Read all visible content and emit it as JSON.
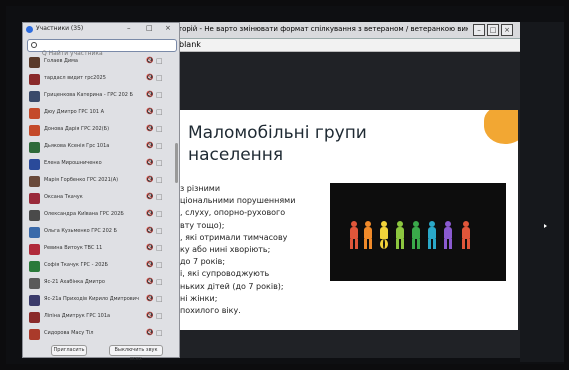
{
  "zoom_window": {
    "title": "торій - Не варто змінювати формат спілкування з ветераном / ветеранкою виключно ч...",
    "doc_name": "blank"
  },
  "slide": {
    "title": "Маломобільні групи населення",
    "bullets": [
      "з різними",
      "ціональними порушеннями",
      ", слуху, опорно-рухового",
      "вту тощо);",
      ", які отримали тимчасову",
      "ку або нині хворіють;",
      "до 7 років;",
      "і, які супроводжують",
      "ньких дітей (до 7 років);",
      "ні жінки;",
      "похилого віку."
    ],
    "accent_color": "#f2a733",
    "image": "inclusion-people-illustration"
  },
  "participants": {
    "title": "Участники (35)",
    "search_placeholder": "Q Найти участника",
    "items": [
      {
        "name": "Голаев Дима",
        "color": "#5a3a2a"
      },
      {
        "name": "тардасл видит грс2025",
        "color": "#8a2a2a"
      },
      {
        "name": "Гриценкова Катерина - ГРС 202 Б",
        "color": "#3a4a6a"
      },
      {
        "name": "Дюу Дмитро ГРС 101 А",
        "color": "#c44a2a"
      },
      {
        "name": "Донова Дарія ГРС 202(Б)",
        "color": "#c44a2a"
      },
      {
        "name": "Дьякова Ксенія Грс 101а",
        "color": "#2e6a3a"
      },
      {
        "name": "Елена Мирошниченко",
        "color": "#2a4a9a"
      },
      {
        "name": "Марія Горбенко ГРС 2021(А)",
        "color": "#6a4a3a"
      },
      {
        "name": "Оксана Ткачук",
        "color": "#9a2a3a"
      },
      {
        "name": "Олександра Київана ГРС 202Б",
        "color": "#4a4a4a"
      },
      {
        "name": "Ольга Кузьменко ГРС 202 Б",
        "color": "#3a6aaa"
      },
      {
        "name": "Ревина Витоук ТВС 11",
        "color": "#b02a3a"
      },
      {
        "name": "Софія Ткачук ГРС - 202Б",
        "color": "#2a7a3a"
      },
      {
        "name": "Яс-21 Ахабінка Дмитро",
        "color": "#5a5a5a"
      },
      {
        "name": "Яс-21а Приходів Кирило Дмитрович",
        "color": "#3a3a6a"
      },
      {
        "name": "Ліпіна Дмитрук ГРС 101а",
        "color": "#8a2a2a"
      },
      {
        "name": "Сидорова Масу Тіл",
        "color": "#aa3a2a"
      }
    ],
    "footer": {
      "invite": "Пригласить",
      "mute_all": "Выключить звук всех"
    }
  }
}
